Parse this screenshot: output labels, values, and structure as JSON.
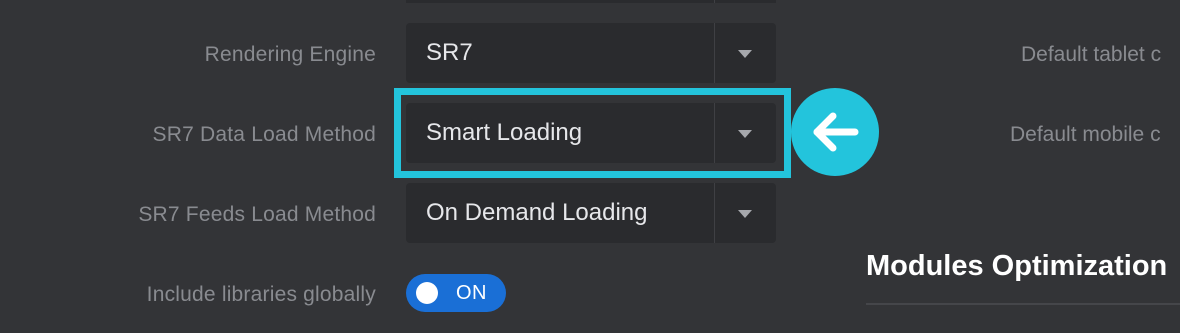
{
  "settings": {
    "rendering_engine": {
      "label": "Rendering Engine",
      "value": "SR7"
    },
    "data_load_method": {
      "label": "SR7 Data Load Method",
      "value": "Smart Loading"
    },
    "feeds_load_method": {
      "label": "SR7 Feeds Load Method",
      "value": "On Demand Loading"
    },
    "include_libraries": {
      "label": "Include libraries globally",
      "toggle_text": "ON",
      "state": "on"
    }
  },
  "right_column": {
    "tablet_label": "Default tablet c",
    "mobile_label": "Default mobile c",
    "section_title": "Modules Optimization"
  },
  "annotation": {
    "highlight_color": "#23c4dc",
    "badge_icon": "arrow-left-icon"
  },
  "colors": {
    "background": "#333437",
    "field": "#2a2b2e",
    "toggle_on": "#1a6fd6",
    "accent": "#23c4dc"
  }
}
